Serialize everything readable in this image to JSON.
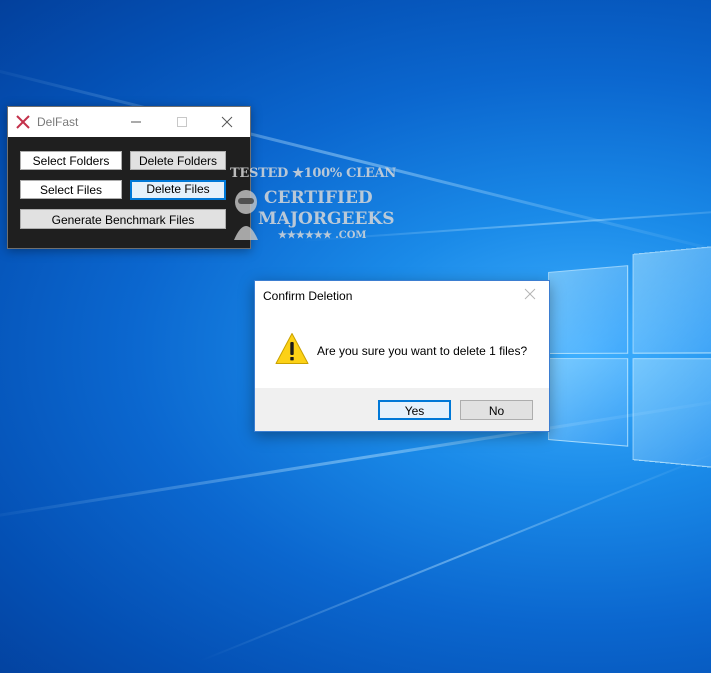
{
  "desktop": {
    "background_color": "#0b67cf"
  },
  "delfast": {
    "title": "DelFast",
    "app_icon": "x-mark-icon",
    "accent_color": "#c4314b",
    "buttons": {
      "select_folders": "Select Folders",
      "delete_folders": "Delete Folders",
      "select_files": "Select Files",
      "delete_files": "Delete Files",
      "generate_benchmark": "Generate Benchmark Files"
    },
    "window_controls": [
      "minimize-icon",
      "maximize-icon",
      "close-icon"
    ]
  },
  "watermark": {
    "line1": "TESTED ★100% CLEAN",
    "line2": "CERTIFIED",
    "line3": "MAJORGEEKS",
    "line4": "★★★★★★ .COM"
  },
  "dialog": {
    "title": "Confirm Deletion",
    "message": "Are you sure you want to delete 1 files?",
    "icon": "warning-icon",
    "yes_label": "Yes",
    "no_label": "No",
    "focus_color": "#0078d7"
  }
}
